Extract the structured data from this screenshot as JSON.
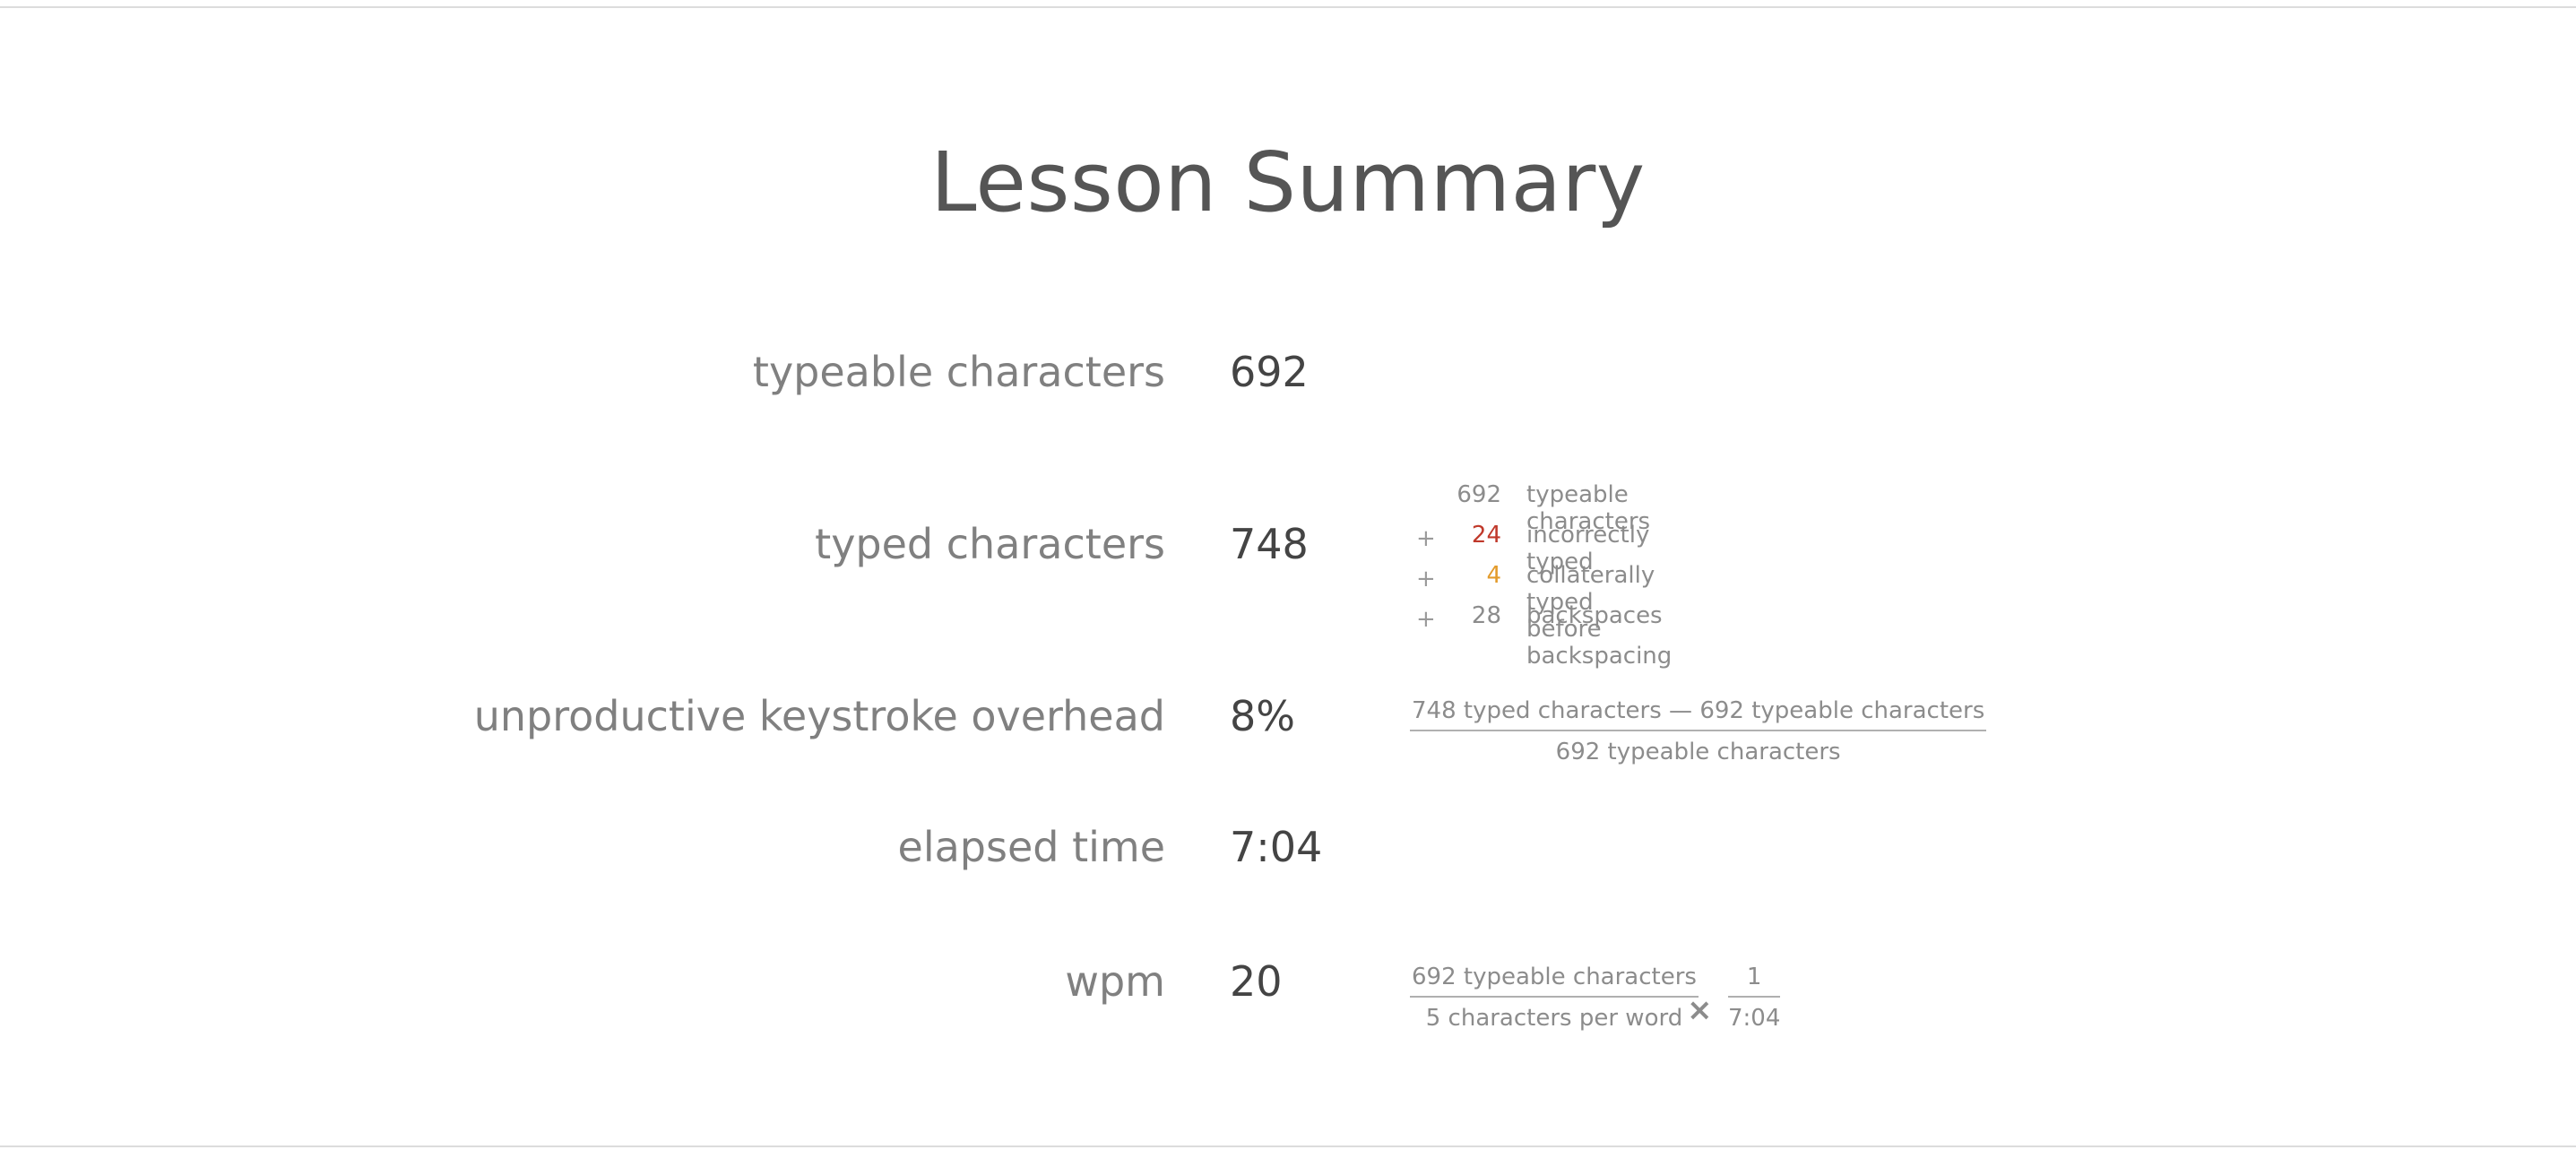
{
  "title": "Lesson Summary",
  "rows": {
    "typeable": {
      "label": "typeable characters",
      "value": "692"
    },
    "typed": {
      "label": "typed characters",
      "value": "748"
    },
    "overhead": {
      "label": "unproductive keystroke overhead",
      "value": "8%"
    },
    "elapsed": {
      "label": "elapsed time",
      "value": "7:04"
    },
    "wpm": {
      "label": "wpm",
      "value": "20"
    }
  },
  "breakdown": [
    {
      "op": "",
      "num": "692",
      "text": "typeable characters",
      "color": "#8c8c8c"
    },
    {
      "op": "+",
      "num": "24",
      "text": "incorrectly typed",
      "color": "#c0392b"
    },
    {
      "op": "+",
      "num": "4",
      "text": "collaterally typed before backspacing",
      "color": "#e39b2b"
    },
    {
      "op": "+",
      "num": "28",
      "text": "backspaces",
      "color": "#8c8c8c"
    }
  ],
  "overhead_formula": {
    "numerator": "748 typed characters — 692 typeable characters",
    "denominator": "692 typeable characters"
  },
  "wpm_formula": {
    "left_numerator": "692 typeable characters",
    "left_denominator": "5 characters per word",
    "operator": "×",
    "right_numerator": "1",
    "right_denominator": "7:04"
  },
  "colors": {
    "incorrect": "#c0392b",
    "collateral": "#e39b2b",
    "label": "#808080",
    "value": "#444444"
  }
}
